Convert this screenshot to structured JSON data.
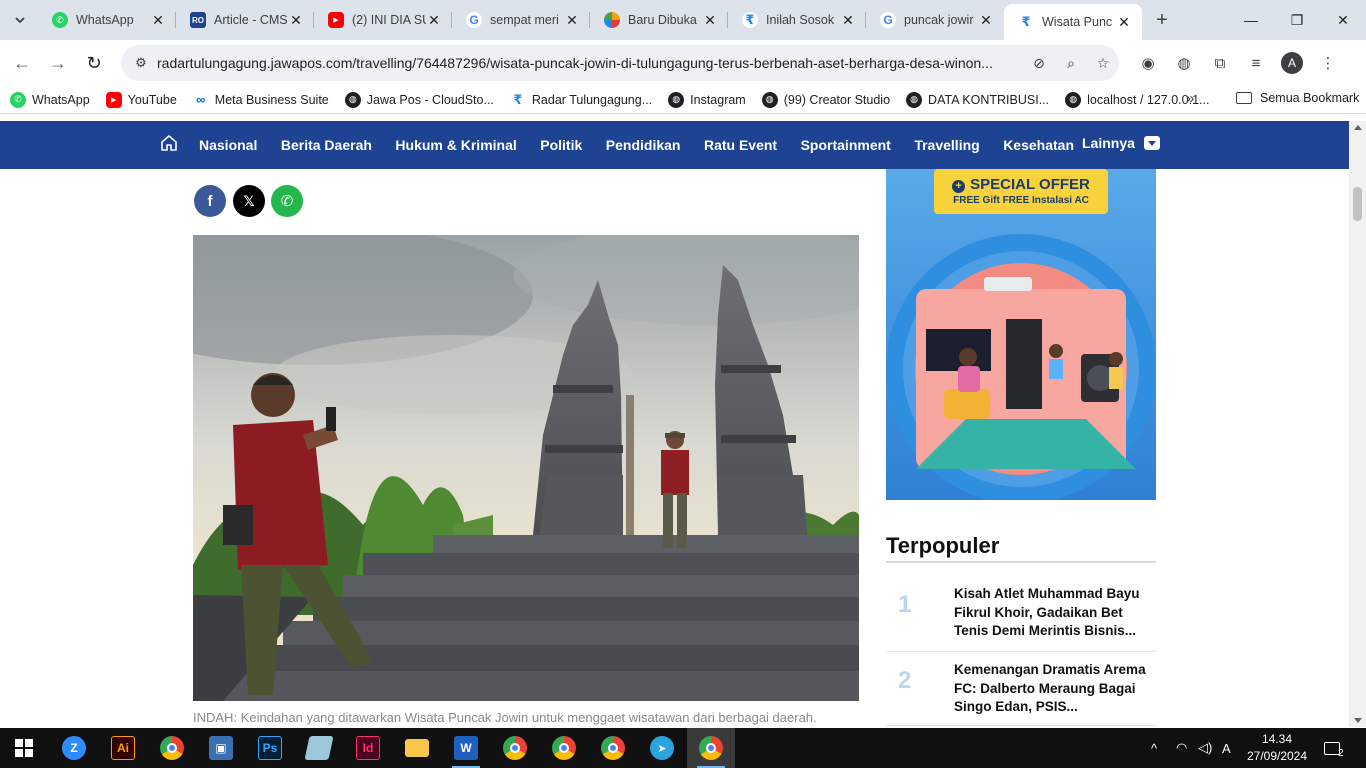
{
  "browser": {
    "tabs": [
      {
        "title": "WhatsApp",
        "favicon_color": "#25d366",
        "active": false
      },
      {
        "title": "Article - CMS",
        "favicon_color": "#1e4392",
        "active": false
      },
      {
        "title": "(2) INI DIA SU",
        "favicon_color": "#ff0000",
        "active": false
      },
      {
        "title": "sempat meri",
        "favicon_color": "#4285f4",
        "active": false
      },
      {
        "title": "Baru Dibuka",
        "favicon_color": "#f4a20c",
        "active": false
      },
      {
        "title": "Inilah Sosok",
        "favicon_color": "#1e88e5",
        "active": false
      },
      {
        "title": "puncak jowir",
        "favicon_color": "#4285f4",
        "active": false
      },
      {
        "title": "Wisata Punc",
        "favicon_color": "#1e88e5",
        "active": true
      }
    ],
    "url": "radartulungagung.jawapos.com/travelling/764487296/wisata-puncak-jowin-di-tulungagung-terus-berbenah-aset-berharga-desa-winon...",
    "profile_initial": "A",
    "bookmarks": [
      {
        "label": "WhatsApp",
        "color": "#25d366"
      },
      {
        "label": "YouTube",
        "color": "#ff0000"
      },
      {
        "label": "Meta Business Suite",
        "color": "#0668e1"
      },
      {
        "label": "Jawa Pos - CloudSto...",
        "color": "#202124"
      },
      {
        "label": "Radar Tulungagung...",
        "color": "#1e88e5"
      },
      {
        "label": "Instagram",
        "color": "#202124"
      },
      {
        "label": "(99) Creator Studio",
        "color": "#202124"
      },
      {
        "label": "DATA KONTRIBUSI...",
        "color": "#202124"
      },
      {
        "label": "localhost / 127.0.0.1...",
        "color": "#202124"
      }
    ],
    "bookmarks_more": "»",
    "all_bookmarks": "Semua Bookmark"
  },
  "site": {
    "nav": [
      "Nasional",
      "Berita Daerah",
      "Hukum & Kriminal",
      "Politik",
      "Pendidikan",
      "Ratu Event",
      "Sportainment",
      "Travelling",
      "Kesehatan"
    ],
    "nav_more": "Lainnya",
    "brand_color": "#1e4392"
  },
  "article": {
    "share": {
      "facebook": "f",
      "x": "𝕏",
      "whatsapp": "✆"
    },
    "caption": "INDAH: Keindahan yang ditawarkan Wisata Puncak Jowin untuk menggaet wisatawan dari berbagai daerah."
  },
  "ad": {
    "headline": "SPECIAL OFFER",
    "subline_prefix": "FREE Gift ",
    "subline_bold": "FREE",
    "subline_suffix": " Instalasi AC"
  },
  "popular": {
    "title": "Terpopuler",
    "items": [
      {
        "rank": "1",
        "title": "Kisah Atlet Muhammad Bayu Fikrul Khoir, Gadaikan Bet Tenis Demi Merintis Bisnis..."
      },
      {
        "rank": "2",
        "title": "Kemenangan Dramatis Arema FC: Dalberto Meraung Bagai Singo Edan, PSIS..."
      }
    ]
  },
  "taskbar": {
    "time": "14.34",
    "date": "27/09/2024",
    "notifications": "2"
  }
}
